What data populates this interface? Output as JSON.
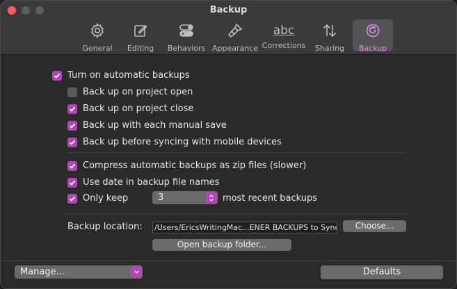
{
  "window": {
    "title": "Backup"
  },
  "toolbar": {
    "items": [
      {
        "label": "General",
        "icon": "gear-icon"
      },
      {
        "label": "Editing",
        "icon": "edit-icon"
      },
      {
        "label": "Behaviors",
        "icon": "toggles-icon"
      },
      {
        "label": "Appearance",
        "icon": "brush-icon"
      },
      {
        "label": "Corrections",
        "icon": "abc-icon",
        "glyph": "abc"
      },
      {
        "label": "Sharing",
        "icon": "arrows-updown-icon"
      },
      {
        "label": "Backup",
        "icon": "backup-icon"
      }
    ],
    "active": "Backup"
  },
  "options": {
    "auto_backups": {
      "label": "Turn on automatic backups",
      "checked": true
    },
    "on_open": {
      "label": "Back up on project open",
      "checked": false
    },
    "on_close": {
      "label": "Back up on project close",
      "checked": true
    },
    "on_save": {
      "label": "Back up with each manual save",
      "checked": true
    },
    "before_sync": {
      "label": "Back up before syncing with mobile devices",
      "checked": true
    },
    "zip": {
      "label": "Compress automatic backups as zip files (slower)",
      "checked": true
    },
    "date_names": {
      "label": "Use date in backup file names",
      "checked": true
    },
    "only_keep": {
      "label": "Only keep",
      "checked": true,
      "value": "3",
      "suffix": "most recent backups"
    }
  },
  "location": {
    "label": "Backup location:",
    "path": "/Users/EricsWritingMac...ENER BACKUPS to Sync",
    "choose_label": "Choose...",
    "open_label": "Open backup folder..."
  },
  "footer": {
    "manage_label": "Manage...",
    "defaults_label": "Defaults"
  },
  "colors": {
    "accent": "#b146b8",
    "active_label": "#e08ee6"
  }
}
